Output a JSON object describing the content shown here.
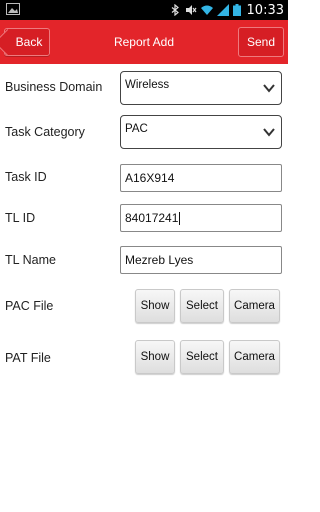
{
  "status_bar": {
    "time": "10:33",
    "icons": [
      "gallery-icon",
      "bluetooth-icon",
      "mute-icon",
      "wifi-icon",
      "signal-icon",
      "battery-icon"
    ]
  },
  "action_bar": {
    "back_label": "Back",
    "title": "Report Add",
    "send_label": "Send",
    "color": "#e3252a"
  },
  "form": {
    "business_domain": {
      "label": "Business Domain",
      "value": "Wireless"
    },
    "task_category": {
      "label": "Task Category",
      "value": "PAC"
    },
    "task_id": {
      "label": "Task ID",
      "value": "A16X914"
    },
    "tl_id": {
      "label": "TL ID",
      "value": "84017241"
    },
    "tl_name": {
      "label": "TL Name",
      "value": "Mezreb Lyes"
    },
    "pac_file": {
      "label": "PAC File",
      "show": "Show",
      "select": "Select",
      "camera": "Camera"
    },
    "pat_file": {
      "label": "PAT File",
      "show": "Show",
      "select": "Select",
      "camera": "Camera"
    }
  }
}
